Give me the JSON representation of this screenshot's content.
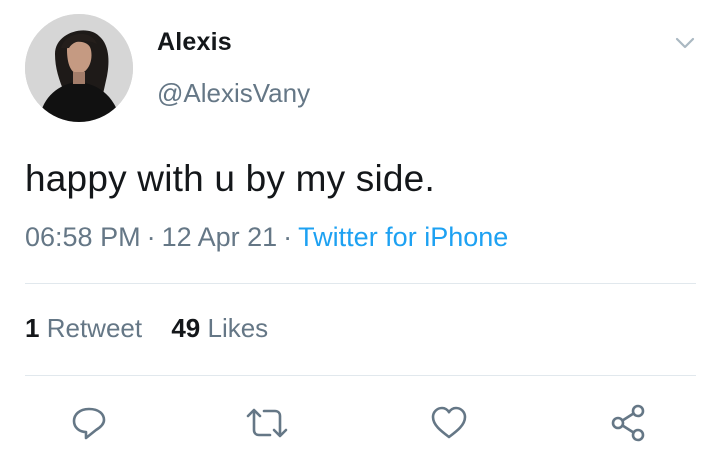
{
  "tweet": {
    "author": {
      "display_name": "Alexis",
      "handle": "@AlexisVany"
    },
    "text": "happy with u by my side.",
    "time": "06:58 PM",
    "date": "12 Apr 21",
    "separator": "·",
    "source": "Twitter for iPhone",
    "stats": {
      "retweets_count": "1",
      "retweets_label": "Retweet",
      "likes_count": "49",
      "likes_label": "Likes"
    }
  },
  "icons": {
    "menu": "chevron-down-icon",
    "reply": "reply-icon",
    "retweet": "retweet-icon",
    "like": "heart-icon",
    "share": "share-icon"
  },
  "colors": {
    "text": "#14171a",
    "secondary": "#657786",
    "link": "#1da1f2",
    "divider": "#e1e8ed"
  }
}
